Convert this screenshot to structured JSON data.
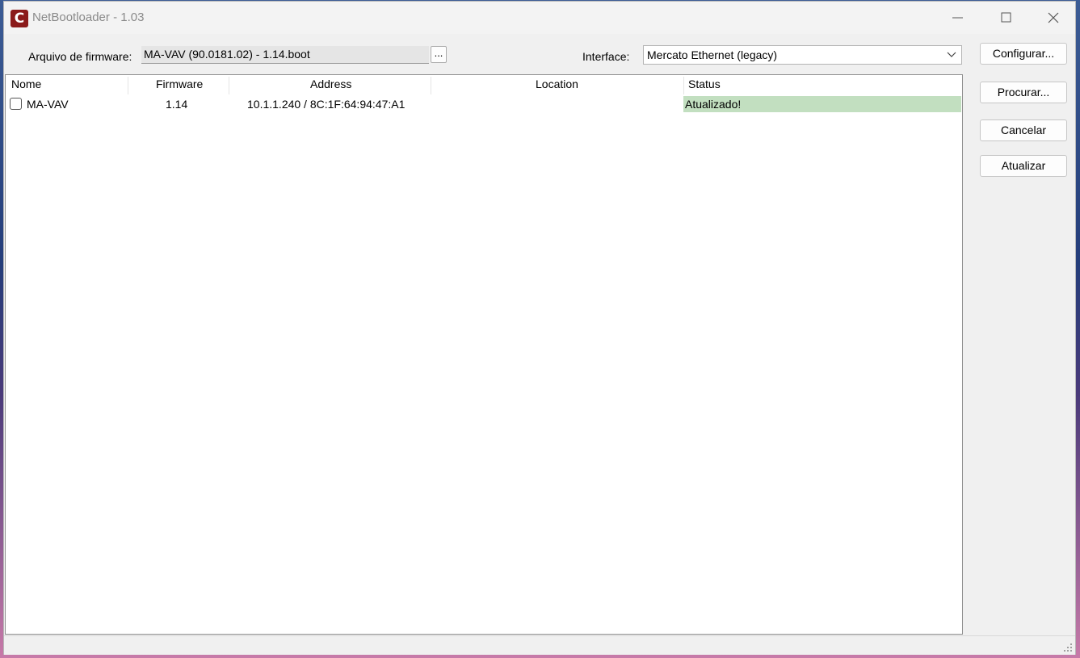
{
  "window": {
    "title": "NetBootloader - 1.03",
    "icon_letter": "C"
  },
  "form": {
    "firmware_label": "Arquivo de firmware:",
    "firmware_value": "MA-VAV (90.0181.02) - 1.14.boot",
    "browse_label": "...",
    "interface_label": "Interface:",
    "interface_value": "Mercato Ethernet (legacy)"
  },
  "buttons": {
    "configure": "Configurar...",
    "search": "Procurar...",
    "cancel": "Cancelar",
    "update": "Atualizar"
  },
  "table": {
    "headers": {
      "name": "Nome",
      "firmware": "Firmware",
      "address": "Address",
      "location": "Location",
      "status": "Status"
    },
    "rows": [
      {
        "checked": false,
        "name": "MA-VAV",
        "firmware": "1.14",
        "address": "10.1.1.240 / 8C:1F:64:94:47:A1",
        "location": "",
        "status": "Atualizado!"
      }
    ]
  },
  "colors": {
    "status_ok": "#c2dfc0",
    "app_icon": "#8b1a1a"
  }
}
